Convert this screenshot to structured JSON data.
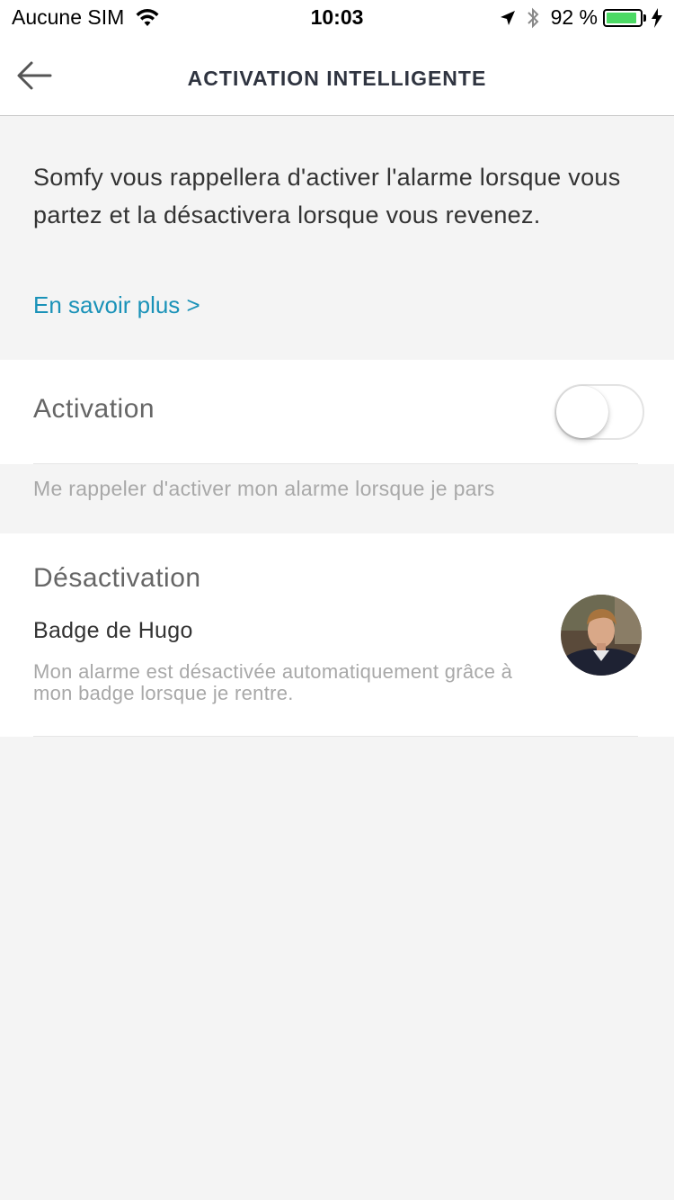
{
  "status_bar": {
    "carrier": "Aucune SIM",
    "time": "10:03",
    "battery_percent_label": "92 %",
    "battery_level": 0.92,
    "icons": [
      "wifi-icon",
      "location-arrow-icon",
      "bluetooth-icon",
      "battery-icon",
      "charging-bolt-icon"
    ]
  },
  "header": {
    "title": "ACTIVATION INTELLIGENTE",
    "back_icon": "back-arrow-icon"
  },
  "intro": {
    "text": "Somfy vous rappellera d'activer l'alarme lorsque vous partez et la désactivera lorsque vous revenez.",
    "learn_more": "En savoir plus >"
  },
  "activation": {
    "label": "Activation",
    "enabled": false,
    "hint": "Me rappeler d'activer mon alarme lorsque je pars"
  },
  "deactivation": {
    "title": "Désactivation",
    "badge_name": "Badge de Hugo",
    "badge_description": "Mon alarme est désactivée automatiquement grâce à mon badge lorsque je rentre."
  },
  "colors": {
    "accent_link": "#1a92b8",
    "background": "#f4f4f4",
    "battery_green": "#4cd964"
  }
}
